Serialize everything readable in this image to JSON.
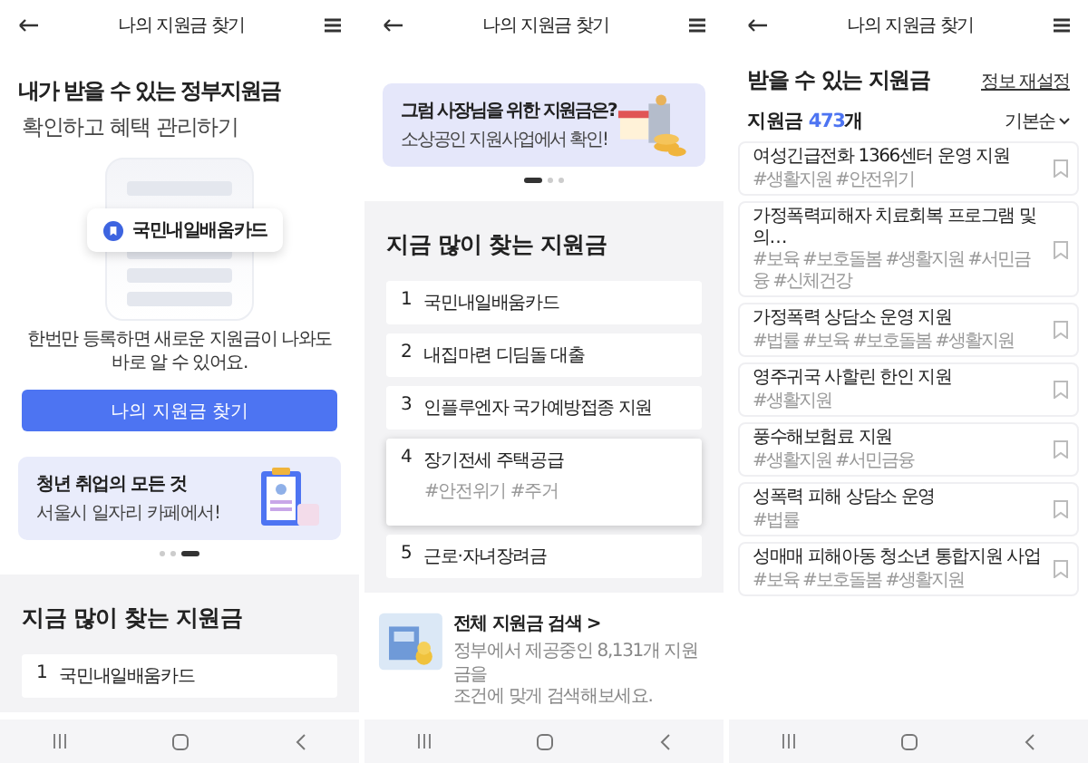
{
  "screens": [
    {
      "kind": "home",
      "header": {
        "title": "나의 지원금 찾기"
      },
      "headline": "내가 받을 수 있는 정부지원금",
      "subheadline": "확인하고 혜택 관리하기",
      "preview_card": "국민내일배움카드",
      "note": "한번만 등록하면 새로운 지원금이 나와도\n바로 알 수 있어요.",
      "button": "나의 지원금 찾기",
      "banner": {
        "title": "청년 취업의 모든 것",
        "subtitle": "서울시 일자리 카페에서!"
      },
      "pager": [
        {
          "selected": false
        },
        {
          "selected": false
        },
        {
          "selected": true
        }
      ],
      "popular": {
        "title": "지금 많이 찾는 지원금",
        "items": [
          {
            "rank": "1",
            "name": "국민내일배움카드",
            "expanded": false
          }
        ]
      }
    },
    {
      "kind": "popular",
      "header": {
        "title": "나의 지원금 찾기"
      },
      "banner": {
        "title": "그럼 사장님을 위한 지원금은?",
        "subtitle": "소상공인 지원사업에서 확인!"
      },
      "pager": [
        {
          "selected": true
        },
        {
          "selected": false
        },
        {
          "selected": false
        }
      ],
      "popular": {
        "title": "지금 많이 찾는 지원금",
        "items": [
          {
            "rank": "1",
            "name": "국민내일배움카드",
            "expanded": false
          },
          {
            "rank": "2",
            "name": "내집마련 디딤돌 대출",
            "expanded": false
          },
          {
            "rank": "3",
            "name": "인플루엔자 국가예방접종 지원",
            "expanded": false
          },
          {
            "rank": "4",
            "name": "장기전세 주택공급",
            "expanded": true,
            "tags": "#안전위기 #주거"
          },
          {
            "rank": "5",
            "name": "근로·자녀장려금",
            "expanded": false
          }
        ]
      },
      "search_link": {
        "title": "전체 지원금 검색 >",
        "description": "정부에서 제공중인 8,131개 지원금을\n조건에 맞게 검색해보세요."
      }
    },
    {
      "kind": "results",
      "header": {
        "title": "나의 지원금 찾기"
      },
      "title": "받을 수 있는 지원금",
      "reset_link": "정보 재설정",
      "count": {
        "label": "지원금",
        "number": "473",
        "unit": "개"
      },
      "sort": "기본순",
      "items": [
        {
          "name": "여성긴급전화 1366센터 운영 지원",
          "tags": "#생활지원 #안전위기"
        },
        {
          "name": "가정폭력피해자 치료회복 프로그램 및 의…",
          "tags": "#보육 #보호돌봄 #생활지원 #서민금융 #신체건강"
        },
        {
          "name": "가정폭력 상담소 운영 지원",
          "tags": "#법률 #보육 #보호돌봄 #생활지원"
        },
        {
          "name": "영주귀국 사할린 한인 지원",
          "tags": "#생활지원"
        },
        {
          "name": "풍수해보험료 지원",
          "tags": "#생활지원 #서민금융"
        },
        {
          "name": "성폭력 피해 상담소 운영",
          "tags": "#법률"
        },
        {
          "name": "성매매 피해아동 청소년 통합지원 사업",
          "tags": "#보육 #보호돌봄 #생활지원"
        }
      ]
    }
  ]
}
